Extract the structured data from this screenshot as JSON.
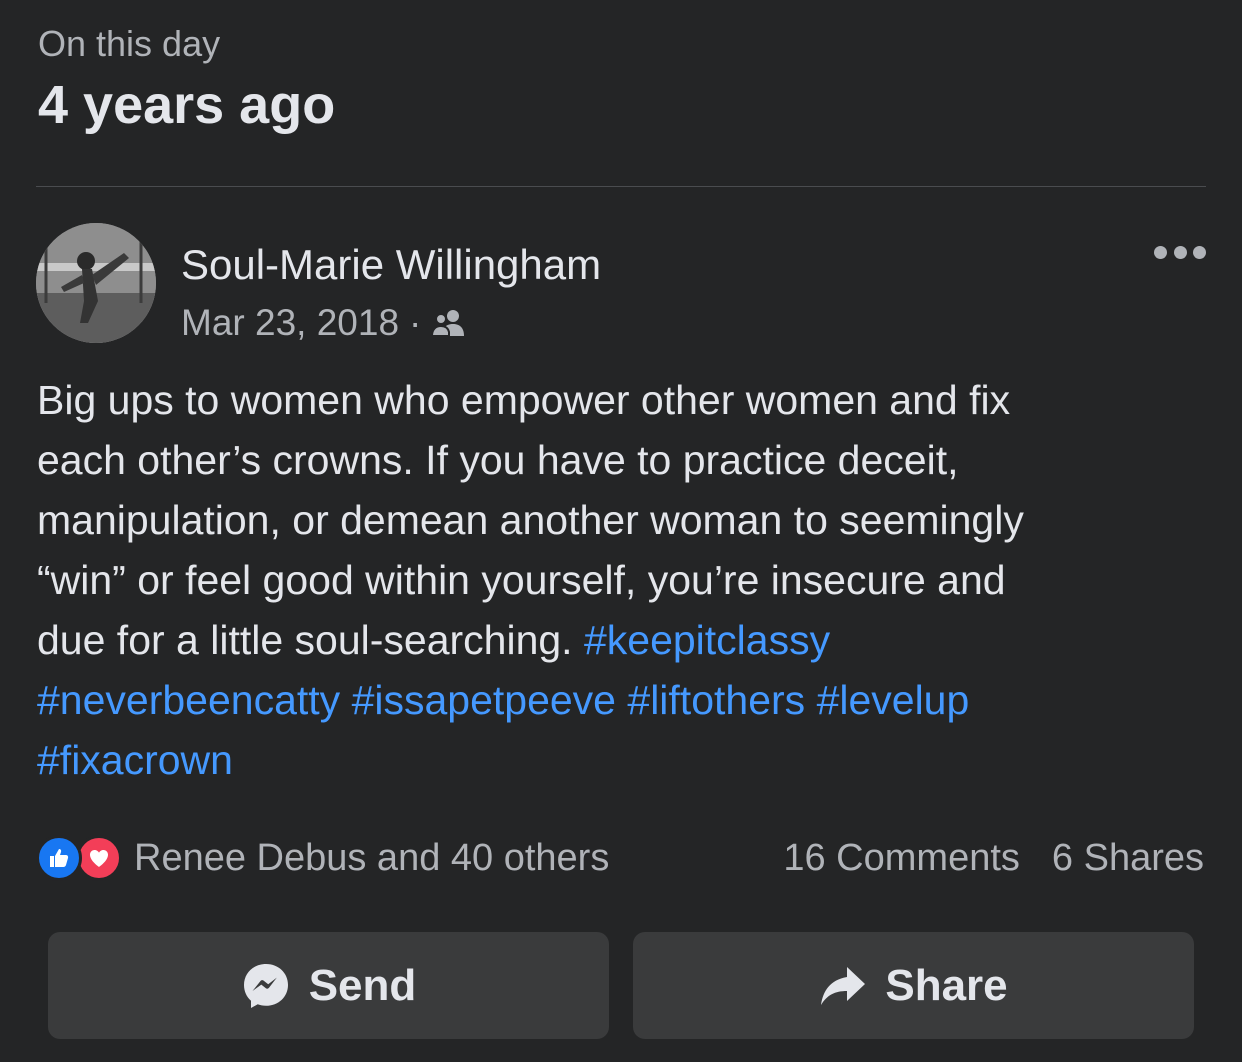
{
  "header": {
    "subtitle": "On this day",
    "title": "4 years ago"
  },
  "post": {
    "author": "Soul-Marie Willingham",
    "date": "Mar 23, 2018",
    "separator": "·",
    "audience_icon": "friends-icon",
    "text_lines": [
      "Big ups to women who empower other women and fix",
      "each other’s crowns. If you have to practice deceit,",
      "manipulation, or demean another woman to seemingly",
      "“win” or feel good within yourself, you’re insecure and",
      "due for a little soul-searching. "
    ],
    "hashtags": [
      "#keepitclassy",
      "#neverbeencatty",
      "#issapetpeeve",
      "#liftothers",
      "#levelup",
      "#fixacrown"
    ]
  },
  "engagement": {
    "reactions_text": "Renee Debus and 40 others",
    "comments": "16 Comments",
    "shares": "6 Shares"
  },
  "actions": {
    "send_label": "Send",
    "share_label": "Share"
  },
  "colors": {
    "background": "#242526",
    "hashtag": "#4599ff",
    "like": "#1877f2",
    "love": "#f33e58"
  }
}
